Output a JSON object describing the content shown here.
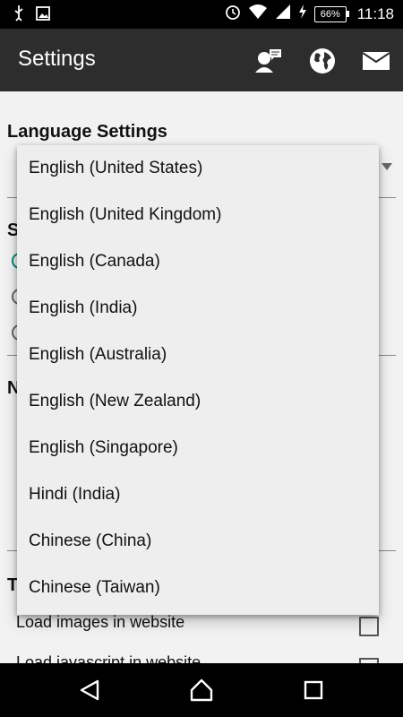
{
  "status_bar": {
    "time": "11:18",
    "battery": "66%",
    "icons": [
      "usb-icon",
      "image-icon",
      "alarm-icon",
      "wifi-icon",
      "signal-icon",
      "charging-icon"
    ]
  },
  "app_bar": {
    "title": "Settings",
    "actions": [
      "chat-person-icon",
      "globe-icon",
      "mail-icon"
    ]
  },
  "background": {
    "language_header": "Language Settings",
    "partial_headers": [
      "S",
      "N",
      "T"
    ],
    "checkbox_label": "Load images in website",
    "cut_off_label": "Load javascript in website"
  },
  "dropdown": {
    "items": [
      "English (United States)",
      "English (United Kingdom)",
      "English (Canada)",
      "English (India)",
      "English (Australia)",
      "English (New Zealand)",
      "English (Singapore)",
      "Hindi (India)",
      "Chinese (China)",
      "Chinese (Taiwan)"
    ]
  },
  "colors": {
    "accent": "#00897b",
    "app_bar": "#2d2d2d"
  }
}
